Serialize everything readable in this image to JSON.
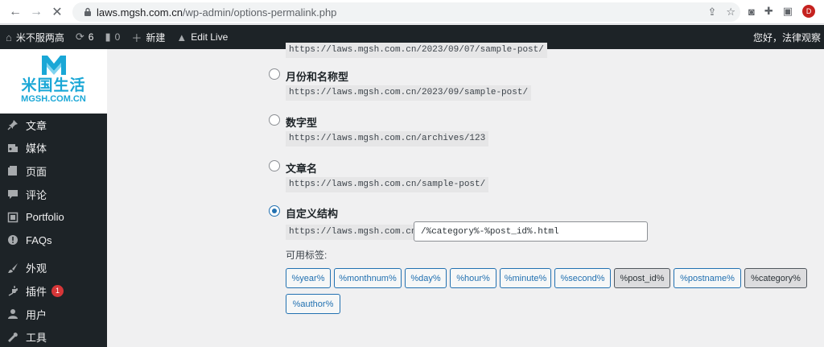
{
  "browser": {
    "url_domain": "laws.mgsh.com.cn",
    "url_path": "/wp-admin/options-permalink.php",
    "profile_initial": "D"
  },
  "adminbar": {
    "site_name": "米不服两高",
    "updates_count": "6",
    "comments_count": "0",
    "new_label": "新建",
    "edit_live_label": "Edit Live",
    "greeting": "您好，法律观察"
  },
  "logo": {
    "cn": "米国生活",
    "en": "MGSH.COM.CN"
  },
  "sidebar": {
    "items": [
      {
        "label": "文章",
        "icon": "pin-icon"
      },
      {
        "label": "媒体",
        "icon": "media-icon"
      },
      {
        "label": "页面",
        "icon": "page-icon"
      },
      {
        "label": "评论",
        "icon": "comment-icon"
      },
      {
        "label": "Portfolio",
        "icon": "portfolio-icon"
      },
      {
        "label": "FAQs",
        "icon": "info-icon"
      },
      {
        "label": "外观",
        "icon": "brush-icon"
      },
      {
        "label": "插件",
        "icon": "plugin-icon",
        "badge": "1"
      },
      {
        "label": "用户",
        "icon": "user-icon"
      },
      {
        "label": "工具",
        "icon": "wrench-icon"
      }
    ]
  },
  "permalinks": {
    "top_example": "https://laws.mgsh.com.cn/2023/09/07/sample-post/",
    "options": [
      {
        "label": "月份和名称型",
        "example": "https://laws.mgsh.com.cn/2023/09/sample-post/",
        "checked": false
      },
      {
        "label": "数字型",
        "example": "https://laws.mgsh.com.cn/archives/123",
        "checked": false
      },
      {
        "label": "文章名",
        "example": "https://laws.mgsh.com.cn/sample-post/",
        "checked": false
      },
      {
        "label": "自定义结构",
        "checked": true
      }
    ],
    "custom_prefix": "https://laws.mgsh.com.cn",
    "custom_value": "/%category%-%post_id%.html",
    "tags_label": "可用标签:",
    "tags": [
      "%year%",
      "%monthnum%",
      "%day%",
      "%hour%",
      "%minute%",
      "%second%",
      "%post_id%",
      "%postname%",
      "%category%",
      "%author%"
    ],
    "active_tags": [
      "%post_id%",
      "%category%"
    ]
  },
  "colors": {
    "accent": "#2271b1",
    "admin_dark": "#1d2327",
    "logo_blue": "#1aa7d6",
    "badge_red": "#d63638"
  }
}
